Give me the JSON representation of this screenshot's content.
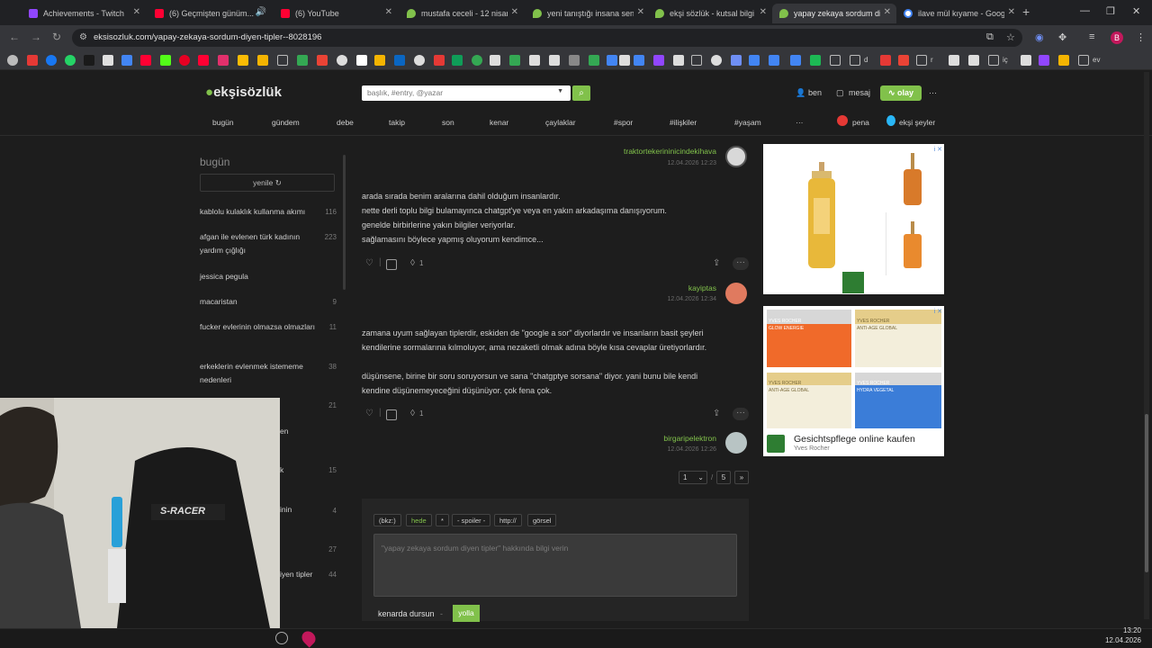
{
  "tabs": [
    {
      "label": "Achievements - Twitch",
      "color": "#9146ff"
    },
    {
      "label": "(6) Geçmişten günüm...",
      "color": "#ff0033"
    },
    {
      "label": "(6) YouTube",
      "color": "#ff0033"
    },
    {
      "label": "mustafa ceceli - 12 nisan",
      "color": "#81c14b"
    },
    {
      "label": "yeni tanıştığı insana sen d",
      "color": "#81c14b"
    },
    {
      "label": "ekşi sözlük - kutsal bilgi k",
      "color": "#81c14b"
    },
    {
      "label": "yapay zekaya sordum diy",
      "color": "#81c14b"
    },
    {
      "label": "ilave mül kıyame - Googl",
      "color": "#4285f4"
    }
  ],
  "browser": {
    "url": "eksisozluk.com/yapay-zekaya-sordum-diyen-tipler--8028196",
    "new_tab": "+",
    "minimize": "—",
    "maximize": "❐",
    "close": "✕",
    "profile_initial": "B",
    "bookmark_labels": [
      "d",
      "r",
      "iç",
      "ev"
    ]
  },
  "site": {
    "logo": "ekşisözlük",
    "search_placeholder": "başlık, #entry, @yazar",
    "user": "ben",
    "messages": "mesaj",
    "events": "olay",
    "more": "···",
    "categories": [
      "bugün",
      "gündem",
      "debe",
      "takip",
      "son",
      "kenar",
      "çaylaklar",
      "#spor",
      "#ilişkiler",
      "#yaşam",
      "···"
    ],
    "pena": "pena",
    "eksi_seyler": "ekşi şeyler"
  },
  "sidebar": {
    "title": "bugün",
    "refresh": "yenile",
    "items": [
      {
        "label": "kablolu kulaklık kullanma akımı",
        "count": "116"
      },
      {
        "label": "afgan ile evlenen türk kadının yardım çığlığı",
        "count": "223"
      },
      {
        "label": "jessica pegula",
        "count": ""
      },
      {
        "label": "macaristan",
        "count": "9"
      },
      {
        "label": "fucker evlerinin olmazsa olmazları",
        "count": "11"
      },
      {
        "label": "erkeklerin evlenmek istememe nedenleri",
        "count": "38"
      }
    ],
    "hidden_counts": [
      "21",
      "15",
      "4",
      "27",
      "44"
    ],
    "hidden_fragments": [
      "en",
      "k",
      "inin",
      "iyen tipler"
    ]
  },
  "entries": [
    {
      "author": "traktortekerininicindekihava",
      "date": "12.04.2026 12:23",
      "lines": [],
      "favs": ""
    },
    {
      "author": "",
      "date": "",
      "lines": [
        "arada sırada benim aralarına dahil olduğum insanlardır.",
        "nette derli toplu bilgi bulamayınca chatgpt'ye veya en yakın arkadaşıma danışıyorum.",
        "genelde birbirlerine yakın bilgiler veriyorlar.",
        "sağlamasını böylece yapmış oluyorum kendimce..."
      ],
      "favs": "1"
    },
    {
      "author": "kayiptas",
      "date": "12.04.2026 12:34",
      "lines": [
        "zamana uyum sağlayan tiplerdir, eskiden de \"google a sor\" diyorlardır ve insanların basit şeyleri",
        "kendilerine sormalarına kılmoluyor, ama nezaketli olmak adına böyle kısa cevaplar üretiyorlardır.",
        "",
        "düşünsene, birine bir soru soruyorsun ve sana \"chatgptye sorsana\" diyor. yani bunu bile kendi",
        "kendine düşünemeyeceğini düşünüyor. çok fena çok."
      ],
      "favs": "1"
    },
    {
      "author": "birgaripelektron",
      "date": "12.04.2026 12:26",
      "lines": [],
      "favs": ""
    }
  ],
  "pager": {
    "current": "1",
    "separator": "/",
    "total": "5",
    "next": "»"
  },
  "editor": {
    "buttons": [
      "(bkz:)",
      "hede",
      "*",
      "- spoiler -",
      "http://",
      "görsel"
    ],
    "placeholder": "\"yapay zekaya sordum diyen tipler\" hakkında bilgi verin",
    "draft": "kenarda dursun",
    "draft_sep": "-",
    "send": "yolla"
  },
  "ads": {
    "ad2_title": "Gesichtspflege online kaufen",
    "ad2_brand": "Yves Rocher",
    "ad_info": "i ✕",
    "jar_labels": [
      "YVES ROCHER",
      "YVES ROCHER",
      "YVES ROCHER",
      "YVES ROCHER"
    ],
    "jar_products": [
      "GLOW ENERGIE",
      "ANTI-AGE GLOBAL",
      "ANTI-AGE GLOBAL",
      "HYDRA VEGETAL"
    ]
  },
  "webcam": {
    "chair_brand": "S-RACER"
  },
  "taskbar": {
    "time": "13:20",
    "date": "12.04.2026"
  }
}
